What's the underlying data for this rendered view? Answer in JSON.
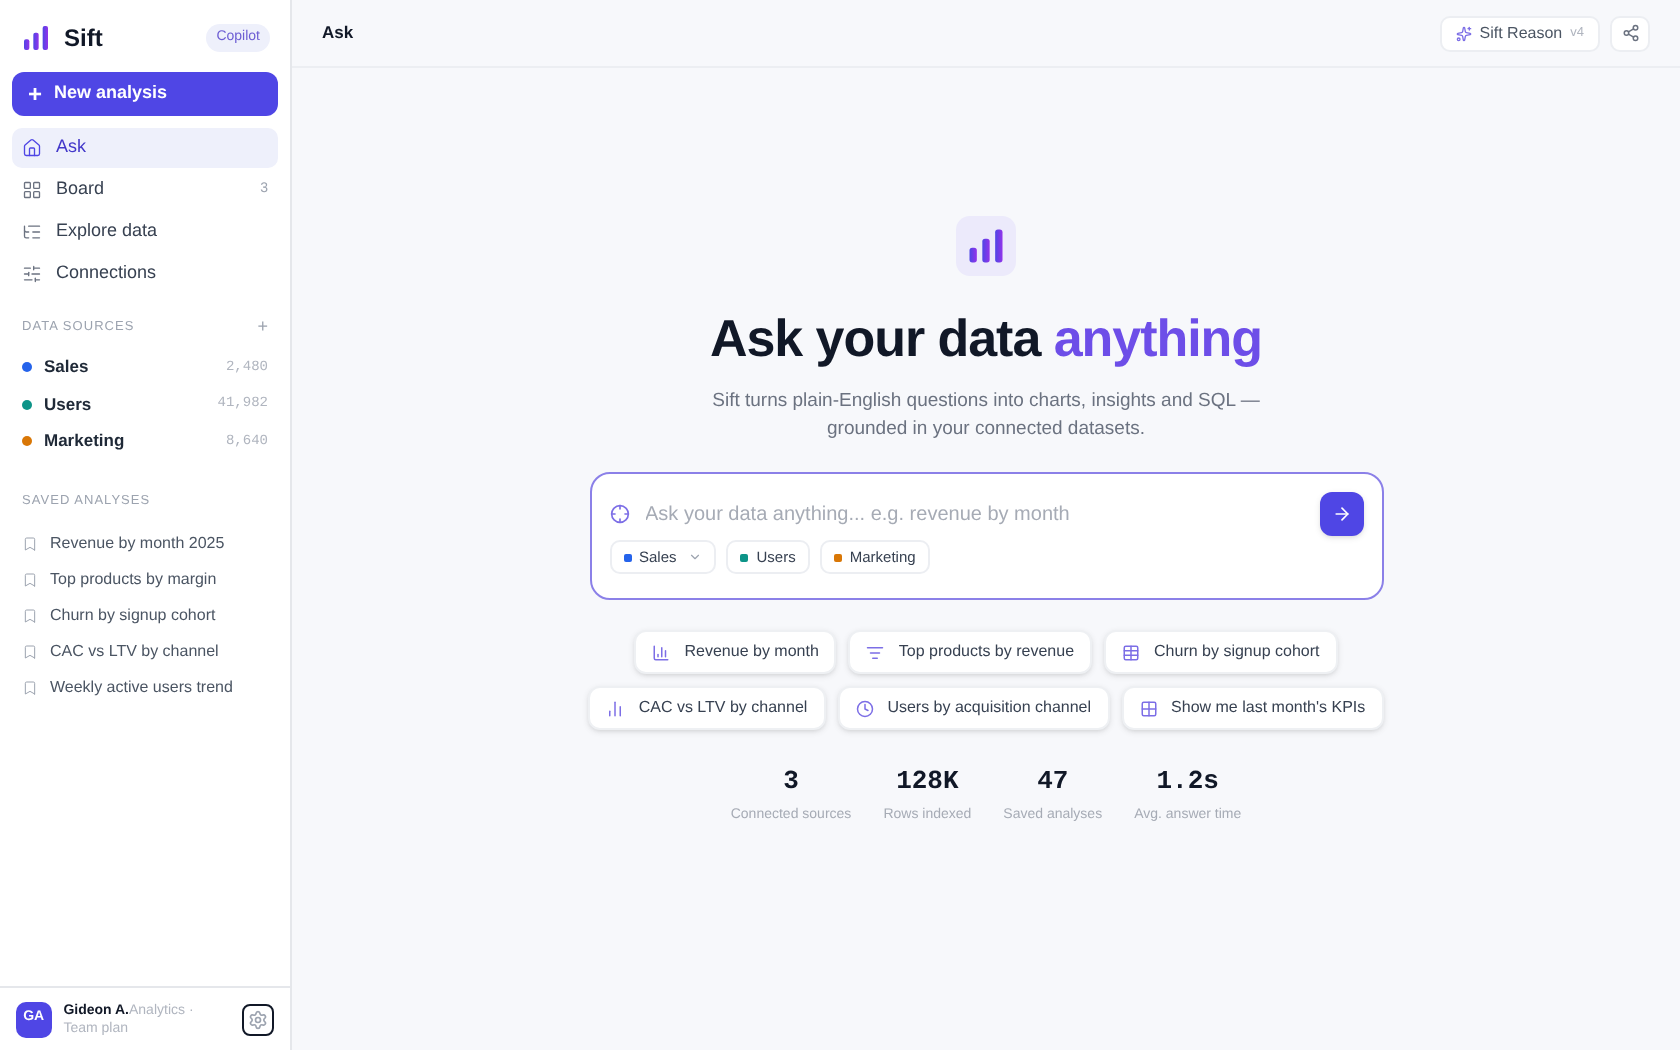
{
  "brand": {
    "name": "Sift",
    "badge": "Copilot"
  },
  "new_button": {
    "label": "New analysis",
    "icon": "+"
  },
  "nav": [
    {
      "label": "Ask",
      "selected": true
    },
    {
      "label": "Board",
      "selected": false,
      "count": "3"
    },
    {
      "label": "Explore data",
      "selected": false
    },
    {
      "label": "Connections",
      "selected": false
    }
  ],
  "data_sources": {
    "heading": "DATA SOURCES",
    "add": "+",
    "items": [
      {
        "name": "Sales",
        "count": "2,480",
        "color": "#2563eb"
      },
      {
        "name": "Users",
        "count": "41,982",
        "color": "#0d9488"
      },
      {
        "name": "Marketing",
        "count": "8,640",
        "color": "#d97706"
      }
    ]
  },
  "saved": {
    "heading": "SAVED ANALYSES",
    "items": [
      "Revenue by month 2025",
      "Top products by margin",
      "Churn by signup cohort",
      "CAC vs LTV by channel",
      "Weekly active users trend"
    ]
  },
  "user": {
    "initials": "GA",
    "name": "Gideon A.",
    "role": "Analytics · Team plan"
  },
  "header": {
    "title": "Ask",
    "model": "Sift Reason",
    "version": "v4"
  },
  "hero": {
    "title": "Ask your data",
    "accent": "anything",
    "subtitle": "Sift turns plain-English questions into charts, insights and SQL — grounded in your connected datasets."
  },
  "query": {
    "placeholder": "Ask your data anything... e.g. revenue by month",
    "chips": [
      {
        "label": "Sales",
        "color": "#2563eb",
        "dropdown": true
      },
      {
        "label": "Users",
        "color": "#0d9488",
        "dropdown": false
      },
      {
        "label": "Marketing",
        "color": "#d97706",
        "dropdown": false
      }
    ]
  },
  "suggestions": [
    [
      "Revenue by month",
      "Top products by revenue",
      "Churn by signup cohort"
    ],
    [
      "CAC vs LTV by channel",
      "Users by acquisition channel",
      "Show me last month's KPIs"
    ]
  ],
  "stats": [
    {
      "value": "3",
      "label": "Connected sources"
    },
    {
      "value": "128K",
      "label": "Rows indexed"
    },
    {
      "value": "47",
      "label": "Saved analyses"
    },
    {
      "value": "1.2s",
      "label": "Avg. answer time"
    }
  ]
}
